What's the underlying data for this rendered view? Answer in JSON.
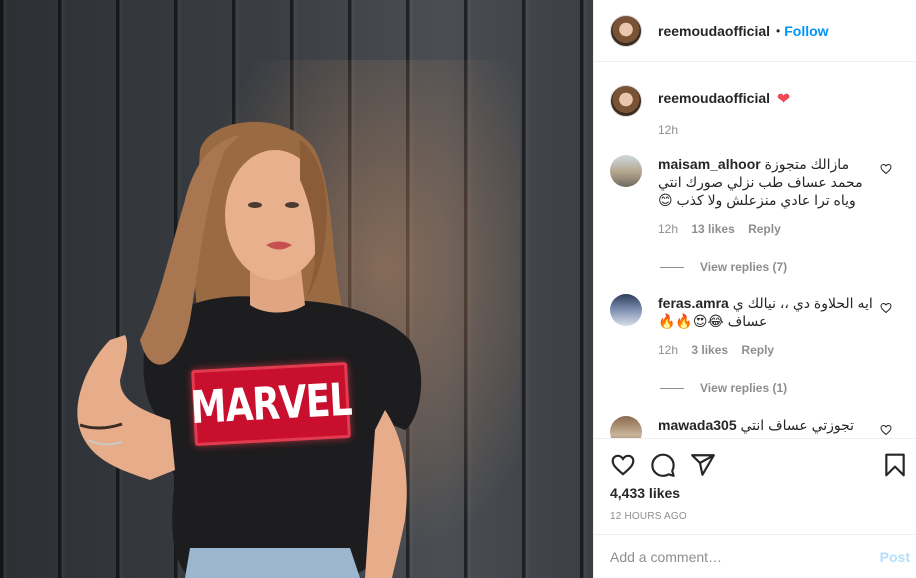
{
  "post": {
    "username": "reemoudaofficial",
    "follow_label": "Follow",
    "dot": "•",
    "photo_text": "MARVEL"
  },
  "caption": {
    "username": "reemoudaofficial",
    "emoji": "❤",
    "time": "12h"
  },
  "comments": [
    {
      "username": "maisam_alhoor",
      "text": "مازالك متجوزة محمد عساف طب نزلي صورك انتي وياه ترا عادي منزعلش ولا كذب 😊",
      "time": "12h",
      "likes": "13 likes",
      "reply": "Reply",
      "view_replies": "View replies (7)"
    },
    {
      "username": "feras.amra",
      "text": "ايه الحلاوة دي ،، نيالك ي عساف 😂😍🔥🔥",
      "time": "12h",
      "likes": "3 likes",
      "reply": "Reply",
      "view_replies": "View replies (1)"
    },
    {
      "username": "mawada305",
      "text": "تجوزتي عساف انتي"
    }
  ],
  "actions": {
    "likes": "4,433 likes",
    "timestamp": "12 HOURS AGO",
    "icons": [
      "heart-icon",
      "comment-icon",
      "share-icon",
      "bookmark-icon"
    ]
  },
  "add_comment": {
    "placeholder": "Add a comment…",
    "post_label": "Post"
  },
  "colors": {
    "accent": "#0095f6",
    "post_disabled": "#b2dffc",
    "muted": "#8e8e8e",
    "heart": "#ed4956"
  }
}
